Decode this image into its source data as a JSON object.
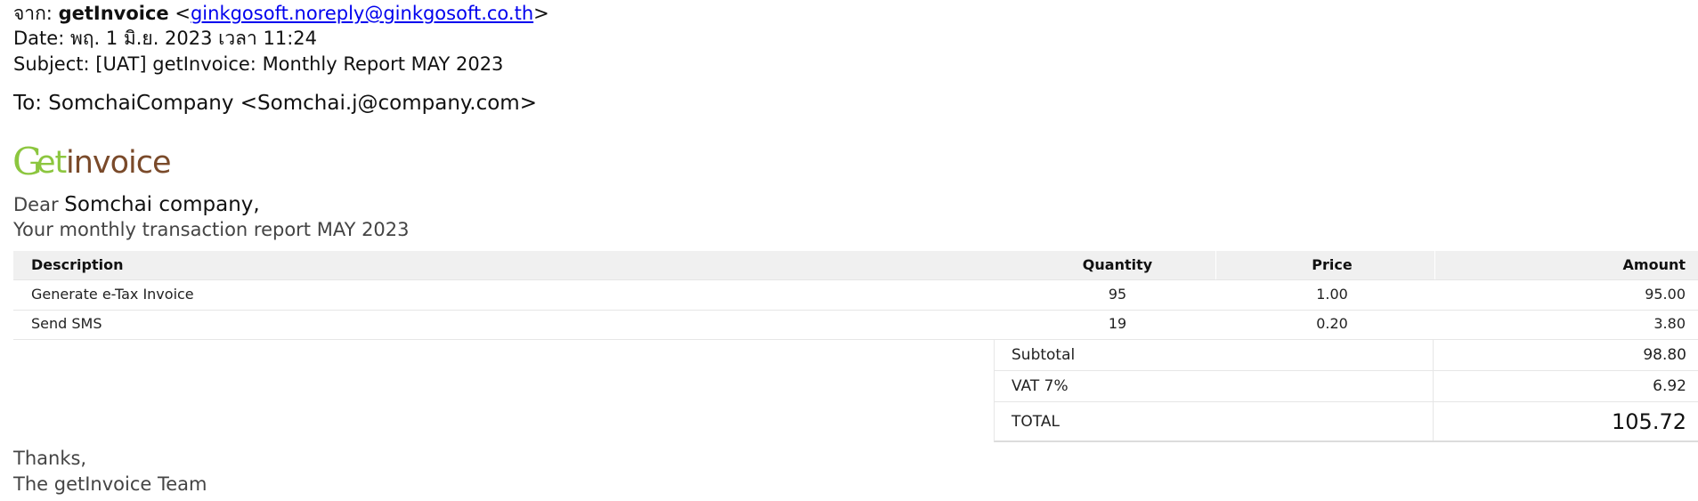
{
  "header": {
    "from_label": "จาก:",
    "sender_name": "getInvoice",
    "sender_email": "ginkgosoft.noreply@ginkgosoft.co.th",
    "date_line": "Date: พฤ. 1 มิ.ย. 2023 เวลา 11:24",
    "subject_line": "Subject: [UAT] getInvoice: Monthly Report MAY 2023",
    "to_line": "To: SomchaiCompany <Somchai.j@company.com>"
  },
  "logo": {
    "part1": "G",
    "part2": "et",
    "part3": "invoice",
    "colors": {
      "green": "#8cc63f",
      "brown": "#7a4a2a"
    }
  },
  "body": {
    "dear_label": "Dear",
    "customer_name": "Somchai company,",
    "report_line": "Your monthly transaction report MAY 2023",
    "thanks": "Thanks,",
    "signature": "The getInvoice Team"
  },
  "table": {
    "headers": {
      "description": "Description",
      "quantity": "Quantity",
      "price": "Price",
      "amount": "Amount"
    },
    "rows": [
      {
        "description": "Generate e-Tax Invoice",
        "quantity": "95",
        "price": "1.00",
        "amount": "95.00"
      },
      {
        "description": "Send SMS",
        "quantity": "19",
        "price": "0.20",
        "amount": "3.80"
      }
    ]
  },
  "totals": {
    "subtotal_label": "Subtotal",
    "subtotal": "98.80",
    "vat_label": "VAT 7%",
    "vat": "6.92",
    "total_label": "TOTAL",
    "total": "105.72"
  }
}
